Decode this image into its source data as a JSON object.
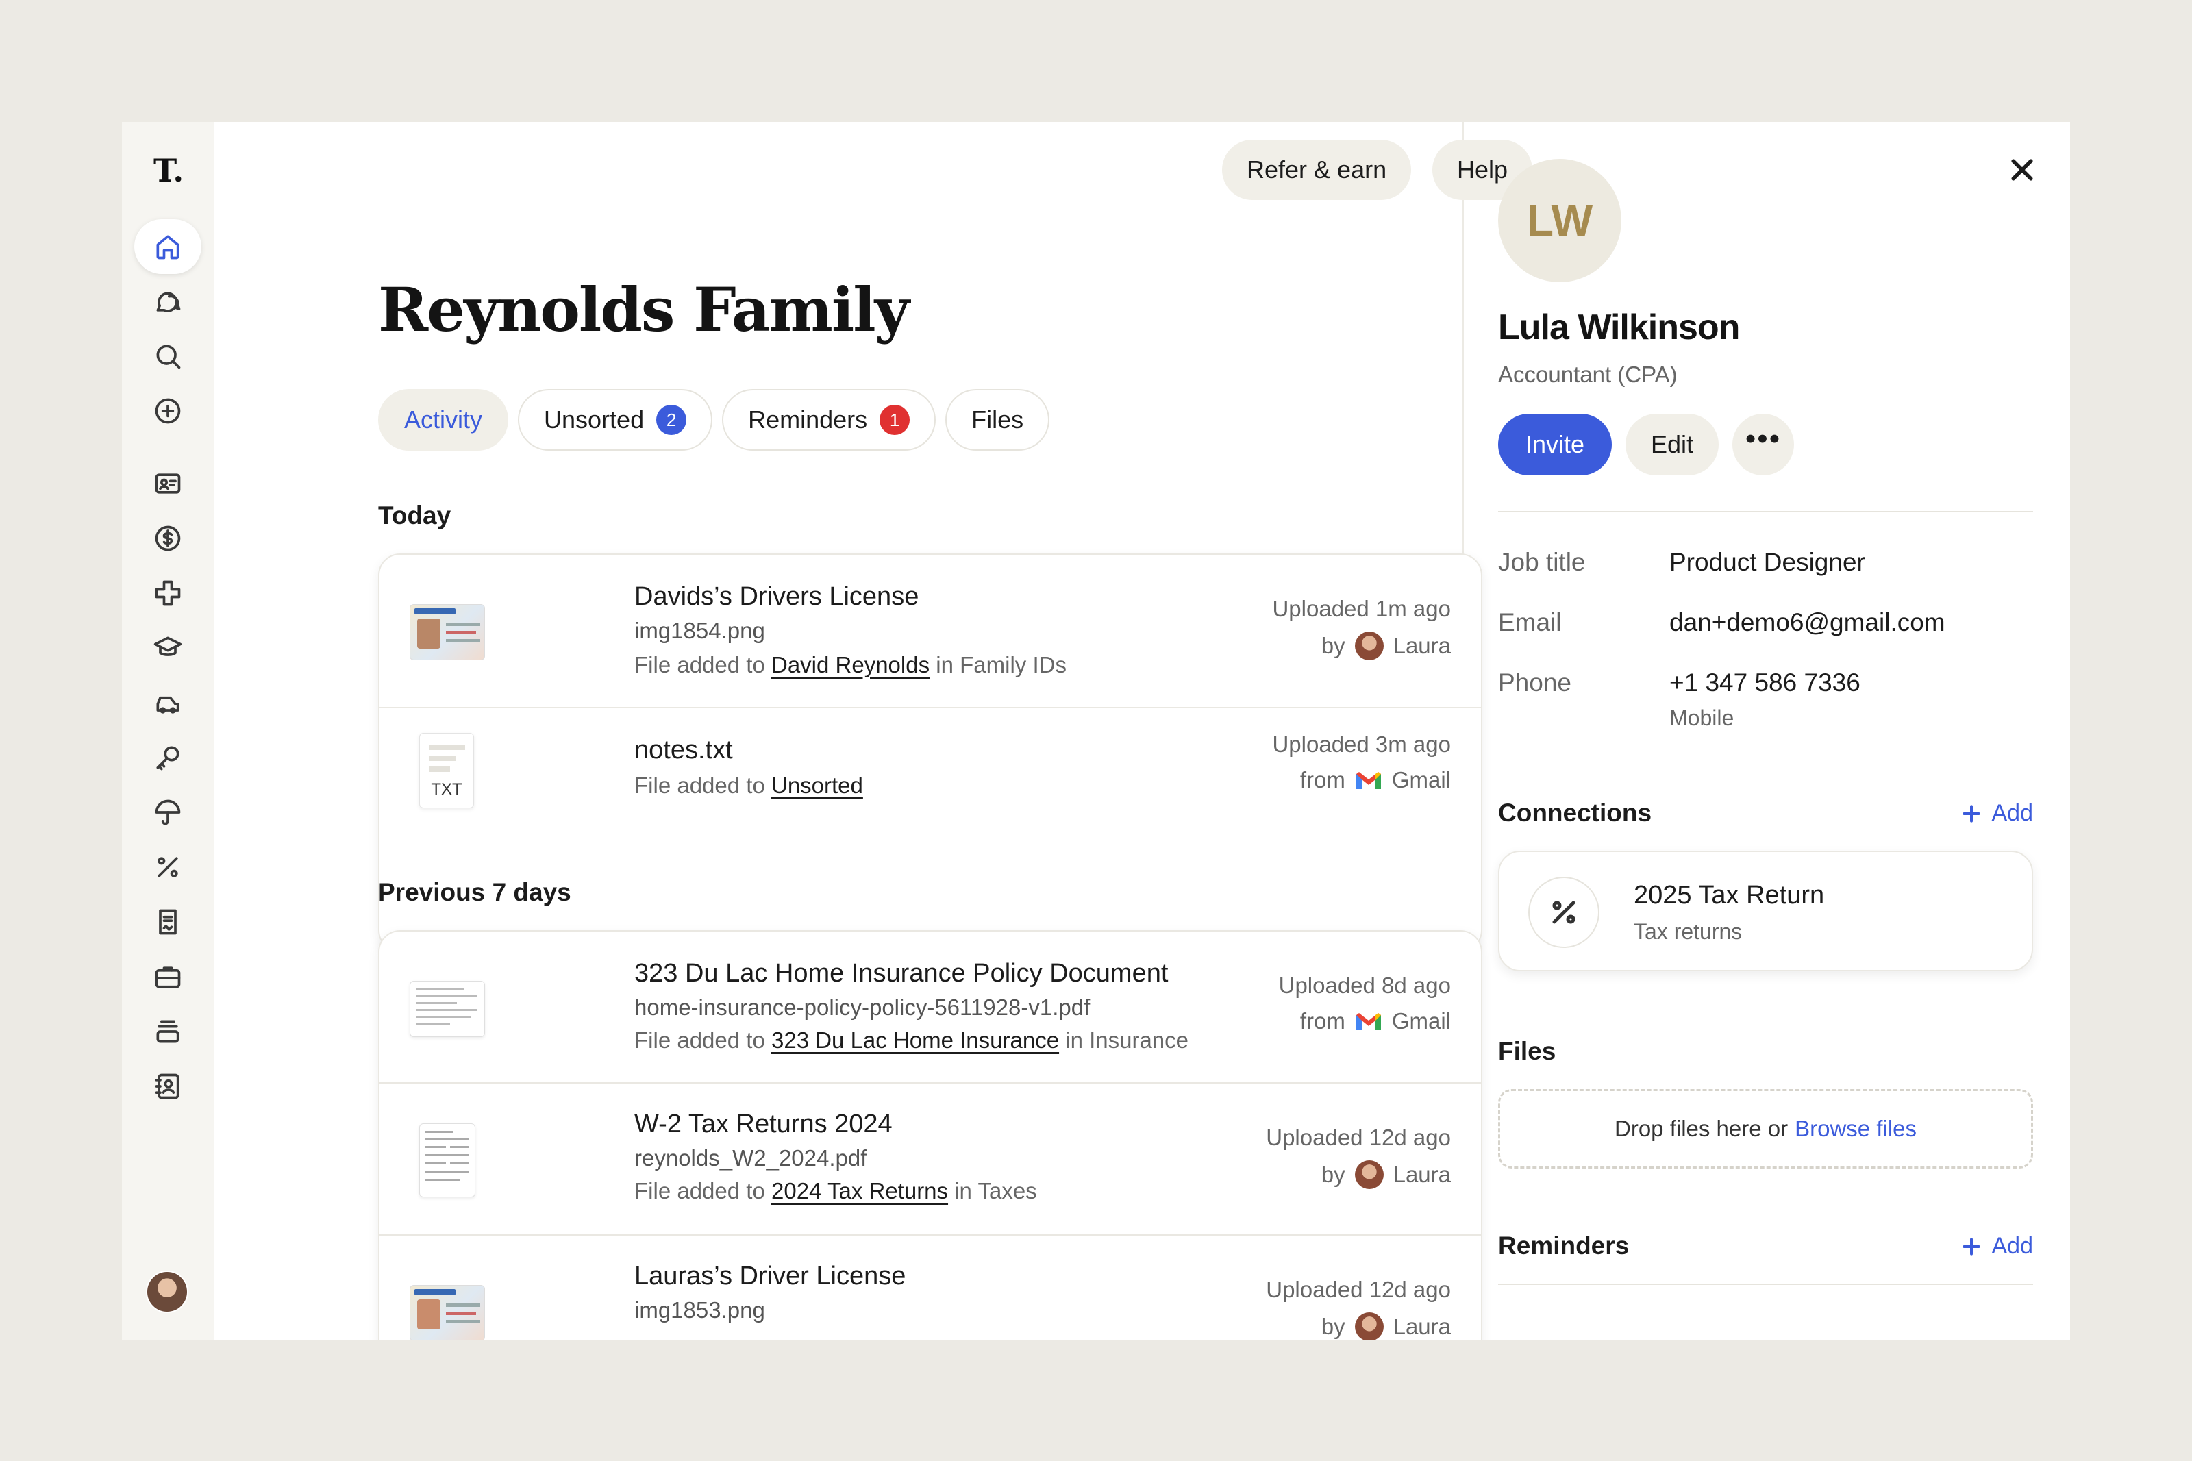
{
  "app": {
    "logo": "T."
  },
  "sidebar": {
    "items": [
      {
        "icon": "home-icon"
      },
      {
        "icon": "chat-icon"
      },
      {
        "icon": "search-icon"
      },
      {
        "icon": "plus-circle-icon"
      },
      {
        "icon": "id-card-icon"
      },
      {
        "icon": "dollar-icon"
      },
      {
        "icon": "medical-cross-icon"
      },
      {
        "icon": "graduation-cap-icon"
      },
      {
        "icon": "car-icon"
      },
      {
        "icon": "key-icon"
      },
      {
        "icon": "umbrella-icon"
      },
      {
        "icon": "percent-icon"
      },
      {
        "icon": "document-sign-icon"
      },
      {
        "icon": "briefcase-icon"
      },
      {
        "icon": "stack-icon"
      },
      {
        "icon": "contact-book-icon"
      }
    ]
  },
  "header": {
    "refer_label": "Refer & earn",
    "help_label": "Help"
  },
  "main": {
    "title": "Reynolds Family",
    "tabs": [
      {
        "label": "Activity"
      },
      {
        "label": "Unsorted",
        "badge": "2"
      },
      {
        "label": "Reminders",
        "badge": "1"
      },
      {
        "label": "Files"
      }
    ],
    "sections": [
      {
        "label": "Today",
        "rows": [
          {
            "title": "Davids’s Drivers License",
            "file": "img1854.png",
            "desc_prefix": "File added to",
            "link": "David Reynolds",
            "desc_suffix": "in Family IDs",
            "time": "Uploaded 1m ago",
            "by_prefix": "by",
            "by": "Laura"
          },
          {
            "title": "notes.txt",
            "thumb_label": "TXT",
            "desc_prefix": "File added to",
            "link": "Unsorted",
            "time": "Uploaded 3m ago",
            "by_prefix": "from",
            "by": "Gmail"
          }
        ]
      },
      {
        "label": "Previous 7 days",
        "rows": [
          {
            "title": "323 Du Lac Home Insurance Policy Document",
            "file": "home-insurance-policy-policy-5611928-v1.pdf",
            "desc_prefix": "File added to",
            "link": "323 Du Lac Home Insurance",
            "desc_suffix": "in Insurance",
            "time": "Uploaded 8d ago",
            "by_prefix": "from",
            "by": "Gmail"
          },
          {
            "title": "W-2 Tax Returns 2024",
            "file": "reynolds_W2_2024.pdf",
            "desc_prefix": "File added to",
            "link": "2024 Tax Returns",
            "desc_suffix": "in Taxes",
            "time": "Uploaded 12d ago",
            "by_prefix": "by",
            "by": "Laura"
          },
          {
            "title": "Lauras’s Driver License",
            "file": "img1853.png",
            "time": "Uploaded 12d ago",
            "by_prefix": "by",
            "by": "Laura"
          }
        ]
      }
    ]
  },
  "panel": {
    "initials": "LW",
    "name": "Lula Wilkinson",
    "role": "Accountant (CPA)",
    "invite_label": "Invite",
    "edit_label": "Edit",
    "more_label": "•••",
    "fields": [
      {
        "key": "Job title",
        "value": "Product Designer"
      },
      {
        "key": "Email",
        "value": "dan+demo6@gmail.com"
      },
      {
        "key": "Phone",
        "value": "+1 347 586 7336",
        "sub": "Mobile"
      }
    ],
    "connections_label": "Connections",
    "add_label": "Add",
    "connection": {
      "title": "2025 Tax Return",
      "subtitle": "Tax returns",
      "icon": "percent-icon"
    },
    "files_label": "Files",
    "dropzone_text": "Drop files here or",
    "browse_label": "Browse files",
    "reminders_label": "Reminders"
  },
  "colors": {
    "accent": "#3B5BDB",
    "alert": "#E03131",
    "background": "#ECEAE4",
    "avatar_text": "#A68B4F"
  }
}
